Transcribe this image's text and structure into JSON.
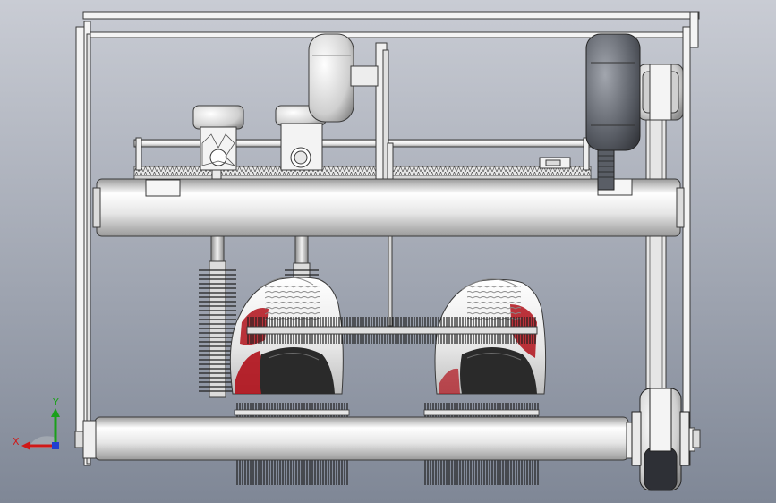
{
  "viewport": {
    "background_top": "#c9ccd4",
    "background_bottom": "#7f8796"
  },
  "triad": {
    "x_label": "X",
    "y_label": "Y",
    "x_color": "#d01818",
    "y_color": "#1aa01a",
    "z_color": "#2040d0"
  },
  "colors": {
    "frame_stroke": "#3a3a3a",
    "frame_fill": "#f4f4f4",
    "beam_light": "#ffffff",
    "beam_mid": "#d8d8d8",
    "beam_dark": "#9a9a9a",
    "motor_dark": "#5a5e66",
    "shoe_red": "#b0101a",
    "brush_dark": "#1e1e1e"
  },
  "icons": {
    "triad": "coordinate-triad-icon"
  }
}
